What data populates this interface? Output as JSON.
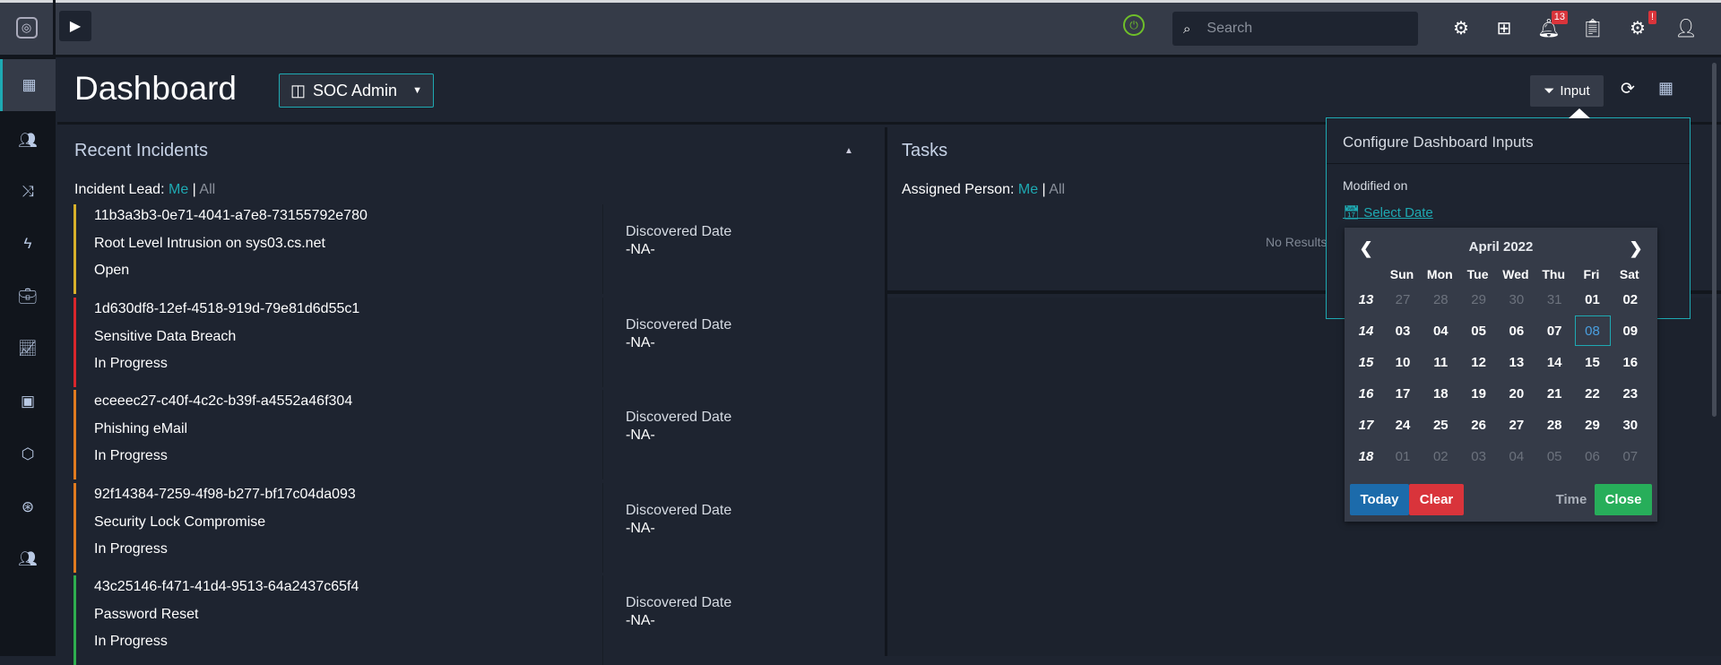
{
  "topbar": {
    "search_placeholder": "Search",
    "notifications_count": "13",
    "alert_badge": "!"
  },
  "header": {
    "title": "Dashboard",
    "dashboard_select": "SOC Admin",
    "input_button": "Input"
  },
  "incidents": {
    "title": "Recent Incidents",
    "filter_label": "Incident Lead:",
    "filter_me": "Me",
    "filter_sep": "|",
    "filter_all": "All",
    "rows": [
      {
        "id": "11b3a3b3-0e71-4041-a7e8-73155792e780",
        "name": "Root Level Intrusion on sys03.cs.net",
        "status": "Open",
        "date_label": "Discovered Date",
        "date": "-NA-",
        "color": "#d8b12a"
      },
      {
        "id": "1d630df8-12ef-4518-919d-79e81d6d55c1",
        "name": "Sensitive Data Breach",
        "status": "In Progress",
        "date_label": "Discovered Date",
        "date": "-NA-",
        "color": "#d9262c"
      },
      {
        "id": "eceeec27-c40f-4c2c-b39f-a4552a46f304",
        "name": "Phishing eMail",
        "status": "In Progress",
        "date_label": "Discovered Date",
        "date": "-NA-",
        "color": "#e07b1f"
      },
      {
        "id": "92f14384-7259-4f98-b277-bf17c04da093",
        "name": "Security Lock Compromise",
        "status": "In Progress",
        "date_label": "Discovered Date",
        "date": "-NA-",
        "color": "#e07b1f"
      },
      {
        "id": "43c25146-f471-41d4-9513-64a2437c65f4",
        "name": "Password Reset",
        "status": "In Progress",
        "date_label": "Discovered Date",
        "date": "-NA-",
        "color": "#2eae4f"
      }
    ]
  },
  "tasks": {
    "title": "Tasks",
    "filter_label": "Assigned Person:",
    "filter_me": "Me",
    "filter_sep": "|",
    "filter_all": "All",
    "empty": "No Results"
  },
  "popup": {
    "title": "Configure Dashboard Inputs",
    "field_label": "Modified on",
    "select_date": "Select Date"
  },
  "calendar": {
    "month": "April 2022",
    "weekdays": [
      "Sun",
      "Mon",
      "Tue",
      "Wed",
      "Thu",
      "Fri",
      "Sat"
    ],
    "weeks": [
      {
        "wk": "13",
        "days": [
          "27",
          "28",
          "29",
          "30",
          "31",
          "01",
          "02"
        ],
        "dim": [
          1,
          1,
          1,
          1,
          1,
          0,
          0
        ]
      },
      {
        "wk": "14",
        "days": [
          "03",
          "04",
          "05",
          "06",
          "07",
          "08",
          "09"
        ],
        "dim": [
          0,
          0,
          0,
          0,
          0,
          0,
          0
        ]
      },
      {
        "wk": "15",
        "days": [
          "10",
          "11",
          "12",
          "13",
          "14",
          "15",
          "16"
        ],
        "dim": [
          0,
          0,
          0,
          0,
          0,
          0,
          0
        ]
      },
      {
        "wk": "16",
        "days": [
          "17",
          "18",
          "19",
          "20",
          "21",
          "22",
          "23"
        ],
        "dim": [
          0,
          0,
          0,
          0,
          0,
          0,
          0
        ]
      },
      {
        "wk": "17",
        "days": [
          "24",
          "25",
          "26",
          "27",
          "28",
          "29",
          "30"
        ],
        "dim": [
          0,
          0,
          0,
          0,
          0,
          0,
          0
        ]
      },
      {
        "wk": "18",
        "days": [
          "01",
          "02",
          "03",
          "04",
          "05",
          "06",
          "07"
        ],
        "dim": [
          1,
          1,
          1,
          1,
          1,
          1,
          1
        ]
      }
    ],
    "selected": "08",
    "today": "Today",
    "clear": "Clear",
    "time": "Time",
    "close": "Close"
  },
  "colors": {
    "accent": "#1ea9b2",
    "today": "#1c6bab",
    "clear": "#d9343b",
    "close": "#27ae5a"
  }
}
